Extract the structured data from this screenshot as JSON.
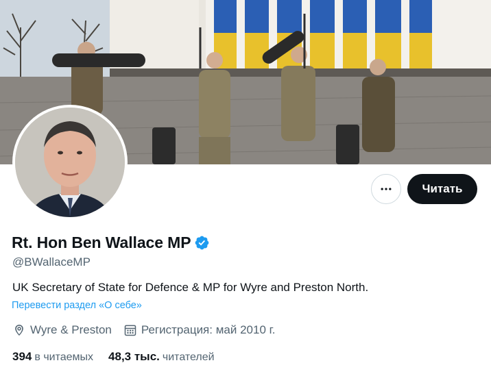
{
  "profile": {
    "display_name": "Rt. Hon Ben Wallace MP",
    "verified": true,
    "handle": "@BWallaceMP",
    "bio": "UK Secretary of State for Defence & MP for Wyre and Preston North.",
    "translate_link": "Перевести раздел «О себе»",
    "location": "Wyre & Preston",
    "joined": "Регистрация: май 2010 г.",
    "following_count": "394",
    "following_label": "в читаемых",
    "followers_count": "48,3 тыс.",
    "followers_label": "читателей"
  },
  "actions": {
    "follow_label": "Читать",
    "more_icon": "more-horizontal-icon"
  },
  "colors": {
    "accent": "#1d9bf0",
    "text_primary": "#0f1419",
    "text_secondary": "#536471",
    "follow_bg": "#0f1419",
    "border": "#cfd9de"
  },
  "icons": {
    "verified": "verified-badge-icon",
    "location": "location-pin-icon",
    "calendar": "calendar-icon"
  }
}
